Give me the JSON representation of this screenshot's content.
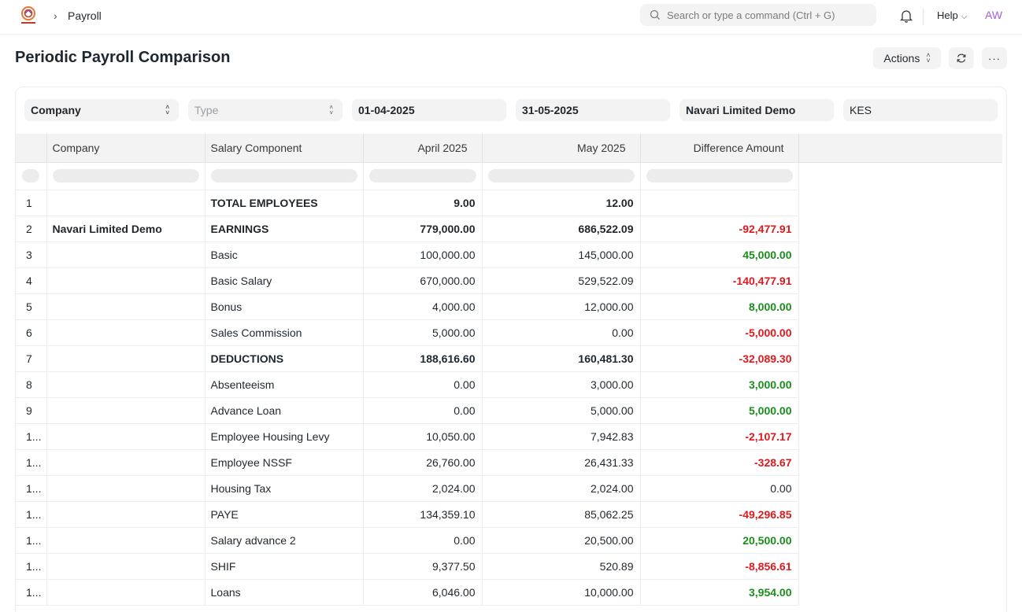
{
  "navbar": {
    "breadcrumb": "Payroll",
    "search_placeholder": "Search or type a command (Ctrl + G)",
    "help_label": "Help",
    "avatar_initials": "AW"
  },
  "page": {
    "title": "Periodic Payroll Comparison",
    "actions_label": "Actions"
  },
  "filters": {
    "company_select": "Company",
    "type_select": "Type",
    "from_date": "01-04-2025",
    "to_date": "31-05-2025",
    "company_name": "Navari Limited Demo",
    "currency": "KES"
  },
  "table": {
    "columns": [
      "Company",
      "Salary Component",
      "April 2025",
      "May 2025",
      "Difference Amount"
    ],
    "rows": [
      {
        "idx": "1",
        "company": "",
        "component": "TOTAL EMPLOYEES",
        "april": "9.00",
        "may": "12.00",
        "diff": "",
        "bold": true,
        "sign": ""
      },
      {
        "idx": "2",
        "company": "Navari Limited Demo",
        "component": "EARNINGS",
        "april": "779,000.00",
        "may": "686,522.09",
        "diff": "-92,477.91",
        "bold": true,
        "sign": "neg"
      },
      {
        "idx": "3",
        "company": "",
        "component": "Basic",
        "april": "100,000.00",
        "may": "145,000.00",
        "diff": "45,000.00",
        "bold": false,
        "sign": "pos"
      },
      {
        "idx": "4",
        "company": "",
        "component": "Basic Salary",
        "april": "670,000.00",
        "may": "529,522.09",
        "diff": "-140,477.91",
        "bold": false,
        "sign": "neg"
      },
      {
        "idx": "5",
        "company": "",
        "component": "Bonus",
        "april": "4,000.00",
        "may": "12,000.00",
        "diff": "8,000.00",
        "bold": false,
        "sign": "pos"
      },
      {
        "idx": "6",
        "company": "",
        "component": "Sales Commission",
        "april": "5,000.00",
        "may": "0.00",
        "diff": "-5,000.00",
        "bold": false,
        "sign": "neg"
      },
      {
        "idx": "7",
        "company": "",
        "component": "DEDUCTIONS",
        "april": "188,616.60",
        "may": "160,481.30",
        "diff": "-32,089.30",
        "bold": true,
        "sign": "neg"
      },
      {
        "idx": "8",
        "company": "",
        "component": "Absenteeism",
        "april": "0.00",
        "may": "3,000.00",
        "diff": "3,000.00",
        "bold": false,
        "sign": "pos"
      },
      {
        "idx": "9",
        "company": "",
        "component": "Advance Loan",
        "april": "0.00",
        "may": "5,000.00",
        "diff": "5,000.00",
        "bold": false,
        "sign": "pos"
      },
      {
        "idx": "1...",
        "company": "",
        "component": "Employee Housing Levy",
        "april": "10,050.00",
        "may": "7,942.83",
        "diff": "-2,107.17",
        "bold": false,
        "sign": "neg"
      },
      {
        "idx": "1...",
        "company": "",
        "component": "Employee NSSF",
        "april": "26,760.00",
        "may": "26,431.33",
        "diff": "-328.67",
        "bold": false,
        "sign": "neg"
      },
      {
        "idx": "1...",
        "company": "",
        "component": "Housing Tax",
        "april": "2,024.00",
        "may": "2,024.00",
        "diff": "0.00",
        "bold": false,
        "sign": "zero"
      },
      {
        "idx": "1...",
        "company": "",
        "component": "PAYE",
        "april": "134,359.10",
        "may": "85,062.25",
        "diff": "-49,296.85",
        "bold": false,
        "sign": "neg"
      },
      {
        "idx": "1...",
        "company": "",
        "component": "Salary advance 2",
        "april": "0.00",
        "may": "20,500.00",
        "diff": "20,500.00",
        "bold": false,
        "sign": "pos"
      },
      {
        "idx": "1...",
        "company": "",
        "component": "SHIF",
        "april": "9,377.50",
        "may": "520.89",
        "diff": "-8,856.61",
        "bold": false,
        "sign": "neg"
      },
      {
        "idx": "1...",
        "company": "",
        "component": "Loans",
        "april": "6,046.00",
        "may": "10,000.00",
        "diff": "3,954.00",
        "bold": false,
        "sign": "pos"
      }
    ]
  },
  "colors": {
    "positive": "#1a8d1a",
    "negative": "#e0191e",
    "avatar": "#a55ee0"
  }
}
